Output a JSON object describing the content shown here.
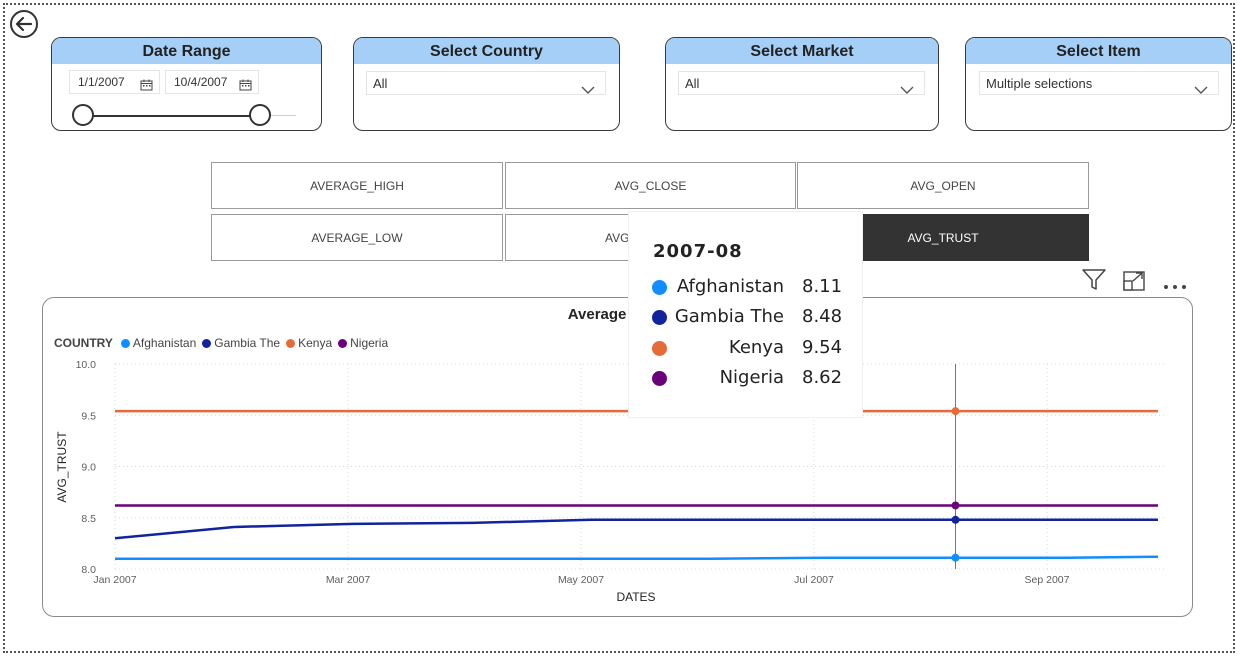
{
  "slicers": {
    "date_range": {
      "title": "Date Range",
      "start": "1/1/2007",
      "end": "10/4/2007",
      "handle_start_fraction": 0.0,
      "handle_end_fraction": 0.83
    },
    "country": {
      "title": "Select Country",
      "value": "All"
    },
    "market": {
      "title": "Select Market",
      "value": "All"
    },
    "item": {
      "title": "Select Item",
      "value": "Multiple selections"
    }
  },
  "measures": {
    "buttons": [
      "AVERAGE_HIGH",
      "AVG_CLOSE",
      "AVG_OPEN",
      "AVERAGE_LOW",
      "AVG",
      "AVG_TRUST"
    ],
    "selected": "AVG_TRUST"
  },
  "chart": {
    "title": "Average Trust by Da",
    "legend_title": "COUNTRY"
  },
  "chart_data": {
    "type": "line",
    "title": "Average Trust by Dates",
    "xlabel": "DATES",
    "ylabel": "AVG_TRUST",
    "ylim": [
      8.0,
      10.0
    ],
    "y_ticks": [
      "8.0",
      "8.5",
      "9.0",
      "9.5",
      "10.0"
    ],
    "x_ticks": [
      "Jan 2007",
      "Mar 2007",
      "May 2007",
      "Jul 2007",
      "Sep 2007"
    ],
    "x": [
      "2007-01",
      "2007-02",
      "2007-03",
      "2007-04",
      "2007-05",
      "2007-06",
      "2007-07",
      "2007-08",
      "2007-09",
      "2007-10"
    ],
    "grid": true,
    "legend_position": "top-left",
    "series": [
      {
        "name": "Afghanistan",
        "color": "#118DFF",
        "values": [
          8.1,
          8.1,
          8.1,
          8.1,
          8.1,
          8.1,
          8.11,
          8.11,
          8.11,
          8.12
        ]
      },
      {
        "name": "Gambia The",
        "color": "#12239E",
        "values": [
          8.3,
          8.41,
          8.44,
          8.45,
          8.48,
          8.48,
          8.48,
          8.48,
          8.48,
          8.48
        ]
      },
      {
        "name": "Kenya",
        "color": "#E66C37",
        "values": [
          9.54,
          9.54,
          9.54,
          9.54,
          9.54,
          9.54,
          9.54,
          9.54,
          9.54,
          9.54
        ]
      },
      {
        "name": "Nigeria",
        "color": "#6B007B",
        "values": [
          8.62,
          8.62,
          8.62,
          8.62,
          8.62,
          8.62,
          8.62,
          8.62,
          8.62,
          8.62
        ]
      }
    ],
    "hover_index": 7
  },
  "tooltip": {
    "title": "2007-08",
    "rows": [
      {
        "name": "Afghanistan",
        "value": "8.11",
        "color": "#118DFF"
      },
      {
        "name": "Gambia The",
        "value": "8.48",
        "color": "#12239E"
      },
      {
        "name": "Kenya",
        "value": "9.54",
        "color": "#E66C37"
      },
      {
        "name": "Nigeria",
        "value": "8.62",
        "color": "#6B007B"
      }
    ]
  },
  "icons": {
    "back": "back-arrow-icon",
    "filter": "filter-icon",
    "focus": "focus-mode-icon",
    "more": "more-options-icon",
    "chevron": "chevron-down-icon",
    "calendar": "calendar-icon"
  }
}
